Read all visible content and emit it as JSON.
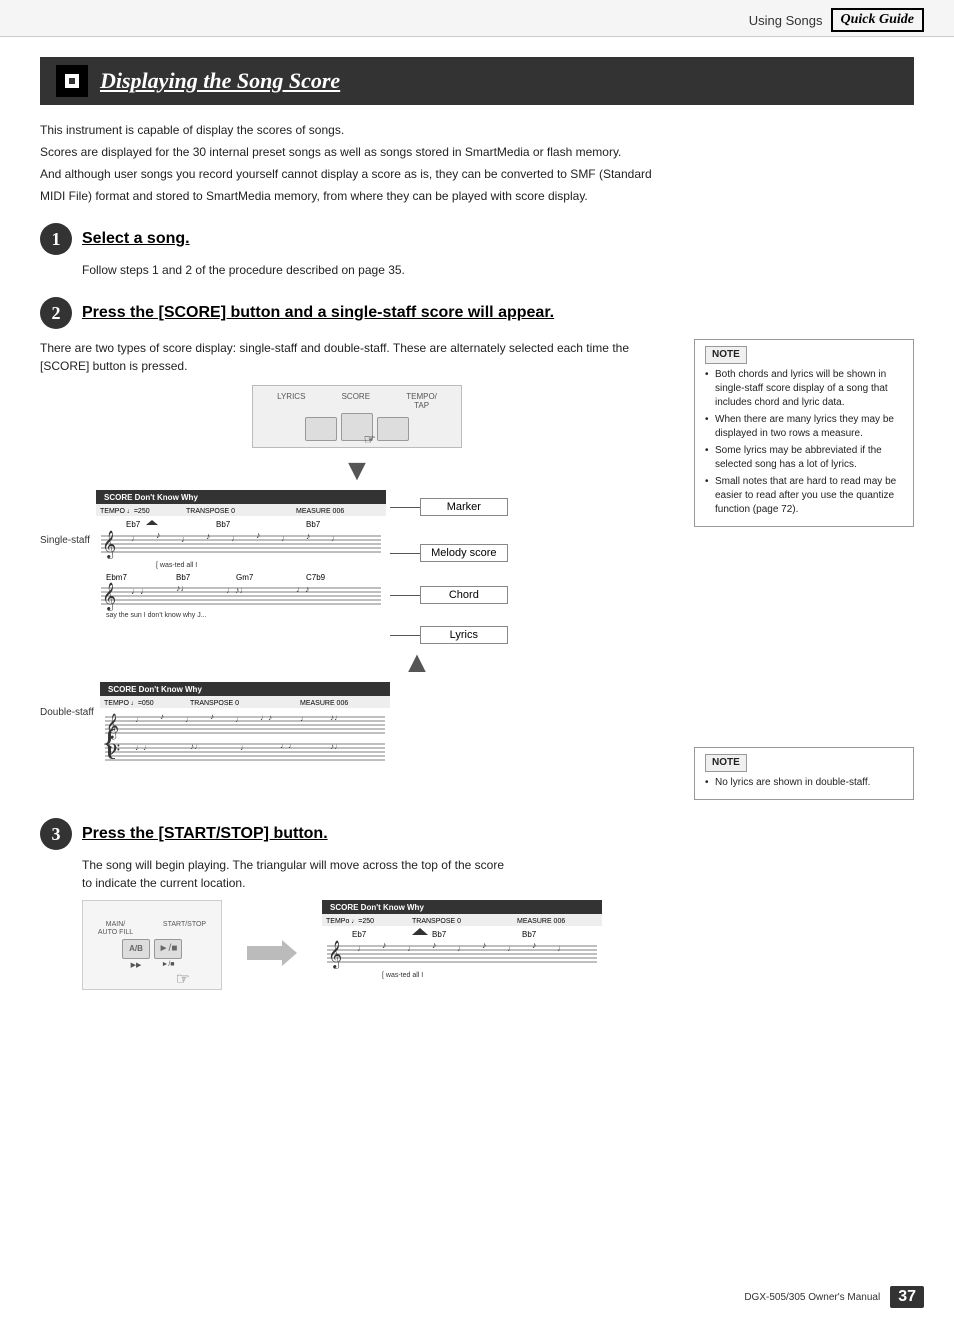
{
  "header": {
    "using_songs": "Using Songs",
    "quick_guide": "Quick Guide"
  },
  "title": {
    "text": "Displaying the Song Score"
  },
  "intro": {
    "line1": "This instrument is capable of display the scores of songs.",
    "line2": "Scores are displayed for the 30 internal preset songs as well as songs stored in SmartMedia or flash memory.",
    "line3": "And although user songs you record yourself cannot display a score as is, they can be converted to SMF (Standard",
    "line4": "MIDI File) format and stored to SmartMedia memory, from where they can be played with score display."
  },
  "step1": {
    "number": "1",
    "title": "Select a song.",
    "body": "Follow steps 1 and 2 of the procedure described on page 35."
  },
  "step2": {
    "number": "2",
    "title": "Press the [SCORE] button and a single-staff score will appear.",
    "body": "There are two types of score display: single-staff and double-staff. These are alternately selected each time the [SCORE] button is pressed.",
    "single_staff_label": "Single-staff",
    "double_staff_label": "Double-staff",
    "callouts": {
      "marker": "Marker",
      "melody_score": "Melody score",
      "chord": "Chord",
      "lyrics": "Lyrics"
    },
    "score1": {
      "title": "SCORE  Don't Know Why",
      "tempo": "TEMPO ♩=250",
      "transpose": "TRANSPOSE  0",
      "measure": "MEASURE 006",
      "chords1": [
        "Eb7",
        "Bb7",
        "Bb7"
      ],
      "chords2": [
        "Ebm7",
        "Bb7",
        "Gm7",
        "C7b9"
      ],
      "lyrics1": "was-ted all  I",
      "lyrics2": "say  the sun        I don't know why  J..."
    },
    "score2": {
      "title": "SCORE  Don't Know Why",
      "tempo": "TEMPO ♩=050",
      "transpose": "TRANSPOSE  0",
      "measure": "MEASURE 006"
    },
    "note1": {
      "title": "NOTE",
      "items": [
        "Both chords and lyrics will be shown in single-staff score display of a song that includes chord and lyric data.",
        "When there are many lyrics they may be displayed in two rows a measure.",
        "Some lyrics may be abbreviated if the selected song has a lot of lyrics.",
        "Small notes that are hard to read may be easier to read after you use the quantize function (page 72)."
      ]
    },
    "note2": {
      "title": "NOTE",
      "items": [
        "No lyrics are shown in double-staff."
      ]
    }
  },
  "step3": {
    "number": "3",
    "title": "Press the [START/STOP] button.",
    "body": "The song will begin playing. The triangular will move across the top of the score\nto indicate the current location.",
    "kb_label1": "MAIN/\nAUTO FILL",
    "kb_label2": "START/STOP",
    "kb_btn1": "A/B",
    "kb_btn2": "►/■",
    "score_title": "SCORE  Don't Know Why",
    "score_tempo": "TEMPo ♩=250",
    "score_transpose": "TRANSPOSE  0",
    "score_measure": "MEASURE 006"
  },
  "footer": {
    "text": "DGX-505/305  Owner's Manual",
    "page": "37"
  }
}
